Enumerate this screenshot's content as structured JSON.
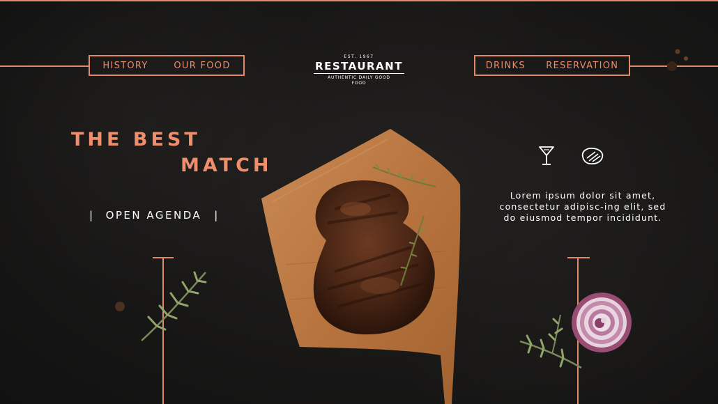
{
  "nav": {
    "left": [
      "HISTORY",
      "OUR FOOD"
    ],
    "right": [
      "DRINKS",
      "RESERVATION"
    ]
  },
  "logo": {
    "est": "EST. 1967",
    "name": "RESTAURANT",
    "tagline": "AUTHENTIC DAILY GOOD FOOD"
  },
  "hero": {
    "line1": "THE BEST",
    "line2": "MATCH"
  },
  "agenda": {
    "label": "OPEN AGENDA",
    "divider": "|"
  },
  "info": {
    "text": "Lorem ipsum dolor sit amet, consectetur adipisc-ing elit, sed do eiusmod tempor incididunt."
  },
  "icons": [
    "cocktail-glass-icon",
    "steak-icon"
  ],
  "colors": {
    "accent": "#e08a6c",
    "background": "#151515",
    "text": "#ffffff"
  }
}
